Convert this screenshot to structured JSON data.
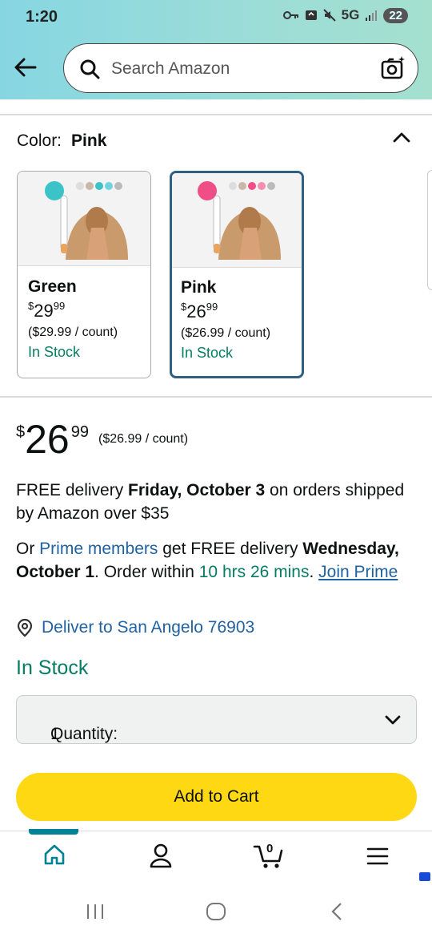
{
  "status_bar": {
    "time": "1:20",
    "network": "5G",
    "battery": "22"
  },
  "search": {
    "placeholder": "Search Amazon"
  },
  "color_selector": {
    "label": "Color:",
    "selected": "Pink",
    "options": [
      {
        "name": "Green",
        "price_symbol": "$",
        "price_whole": "29",
        "price_fraction": "99",
        "unit_price": "($29.99 / count)",
        "stock": "In Stock",
        "brush_color": "#3cc3c8"
      },
      {
        "name": "Pink",
        "price_symbol": "$",
        "price_whole": "26",
        "price_fraction": "99",
        "unit_price": "($26.99 / count)",
        "stock": "In Stock",
        "brush_color": "#ef4f86"
      }
    ]
  },
  "price": {
    "symbol": "$",
    "whole": "26",
    "fraction": "99",
    "per_unit": "($26.99 / count)"
  },
  "delivery": {
    "prefix": "FREE delivery ",
    "date": "Friday, October 3",
    "suffix": " on orders shipped by Amazon over $35"
  },
  "prime": {
    "prefix": "Or ",
    "members_link": "Prime members",
    "middle": " get FREE delivery ",
    "date": "Wednesday, October 1",
    "order_within": ". Order within ",
    "countdown": "10 hrs 26 mins",
    "period": ". ",
    "join_link": "Join Prime"
  },
  "deliver_to": "Deliver to San Angelo 76903",
  "stock_status": "In Stock",
  "quantity": {
    "label": "Quantity:",
    "value": "1"
  },
  "add_to_cart": "Add to Cart",
  "bottom_nav": {
    "cart_count": "0",
    "items": [
      "home",
      "account",
      "cart",
      "menu"
    ]
  },
  "colors": {
    "accent_teal": "#008296",
    "stock_green": "#067d62",
    "link_blue": "#2162a1",
    "cart_yellow": "#ffd814",
    "selected_border": "#2f5f82"
  }
}
